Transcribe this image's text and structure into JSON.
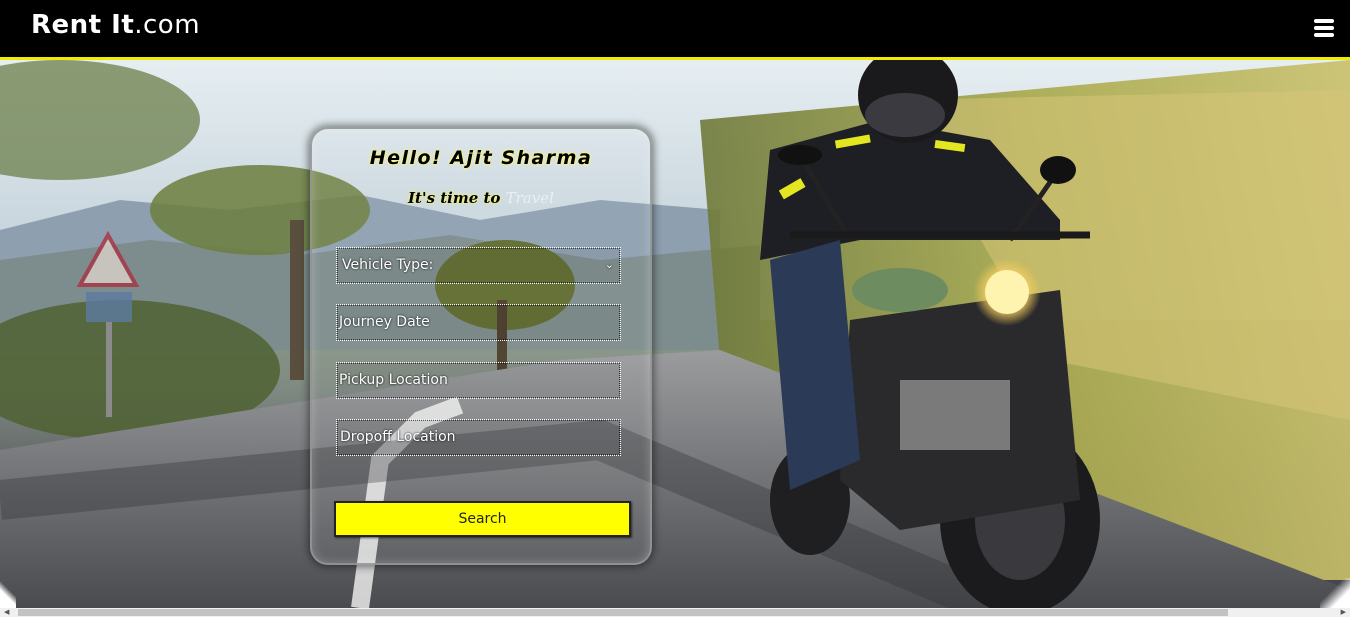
{
  "navbar": {
    "brand_bold": "Rent It",
    "brand_suffix": ".com",
    "menu_icon": "hamburger-menu-icon"
  },
  "hero": {
    "image_subject": "motorcyclist riding on a mountain road"
  },
  "booking_form": {
    "greeting": "Hello! Ajit Sharma",
    "tagline_part1": "It's time to",
    "tagline_part2": "Travel",
    "vehicle_type_label": "Vehicle Type:",
    "journey_date_placeholder": "Journey Date",
    "pickup_placeholder": "Pickup Location",
    "dropoff_placeholder": "Dropoff Location",
    "search_label": "Search"
  },
  "colors": {
    "accent": "#ffff00",
    "navbar_bg": "#000000",
    "navbar_border": "#f2ec00"
  }
}
